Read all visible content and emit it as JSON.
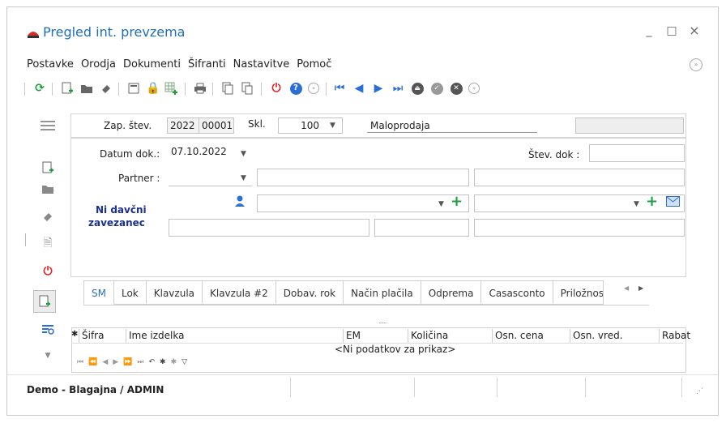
{
  "window": {
    "title": "Pregled int. prevzema",
    "minimize": "_",
    "maximize": "□",
    "close": "×"
  },
  "menu": {
    "items": [
      "Postavke",
      "Orodja",
      "Dokumenti",
      "Šifranti",
      "Nastavitve",
      "Pomoč"
    ]
  },
  "header": {
    "zap_label": "Zap. štev.",
    "zap_year": "2022",
    "zap_num": "00001",
    "skl_label": "Skl.",
    "skl_value": "100",
    "skl_name": "Maloprodaja"
  },
  "form": {
    "datum_label": "Datum dok.:",
    "datum_value": "07.10.2022",
    "stevdok_label": "Štev. dok :",
    "partner_label": "Partner :",
    "ni_davcni_1": "Ni davčni",
    "ni_davcni_2": "zavezanec"
  },
  "tabs": [
    "SM",
    "Lok",
    "Klavzula",
    "Klavzula #2",
    "Dobav. rok",
    "Način plačila",
    "Odprema",
    "Casasconto",
    "Priložnos"
  ],
  "grid": {
    "columns": [
      "✱",
      "Šifra",
      "Ime izdelka",
      "EM",
      "Količina",
      "Osn. cena",
      "Osn. vred.",
      "Rabat"
    ],
    "empty_text": "<Ni podatkov za prikaz>"
  },
  "nav_bar_glyphs": [
    "⏮",
    "⏪",
    "◀",
    "▶",
    "⏩",
    "⏭",
    "↶",
    "✱",
    "✱",
    "▽"
  ],
  "status": {
    "text": "Demo - Blagajna / ADMIN"
  },
  "colors": {
    "title": "#1f6fb5",
    "green": "#1e9e3e",
    "red": "#d92b2b",
    "blue_nav": "#2a6fd6",
    "dark_blue_text": "#1b2f8f"
  }
}
